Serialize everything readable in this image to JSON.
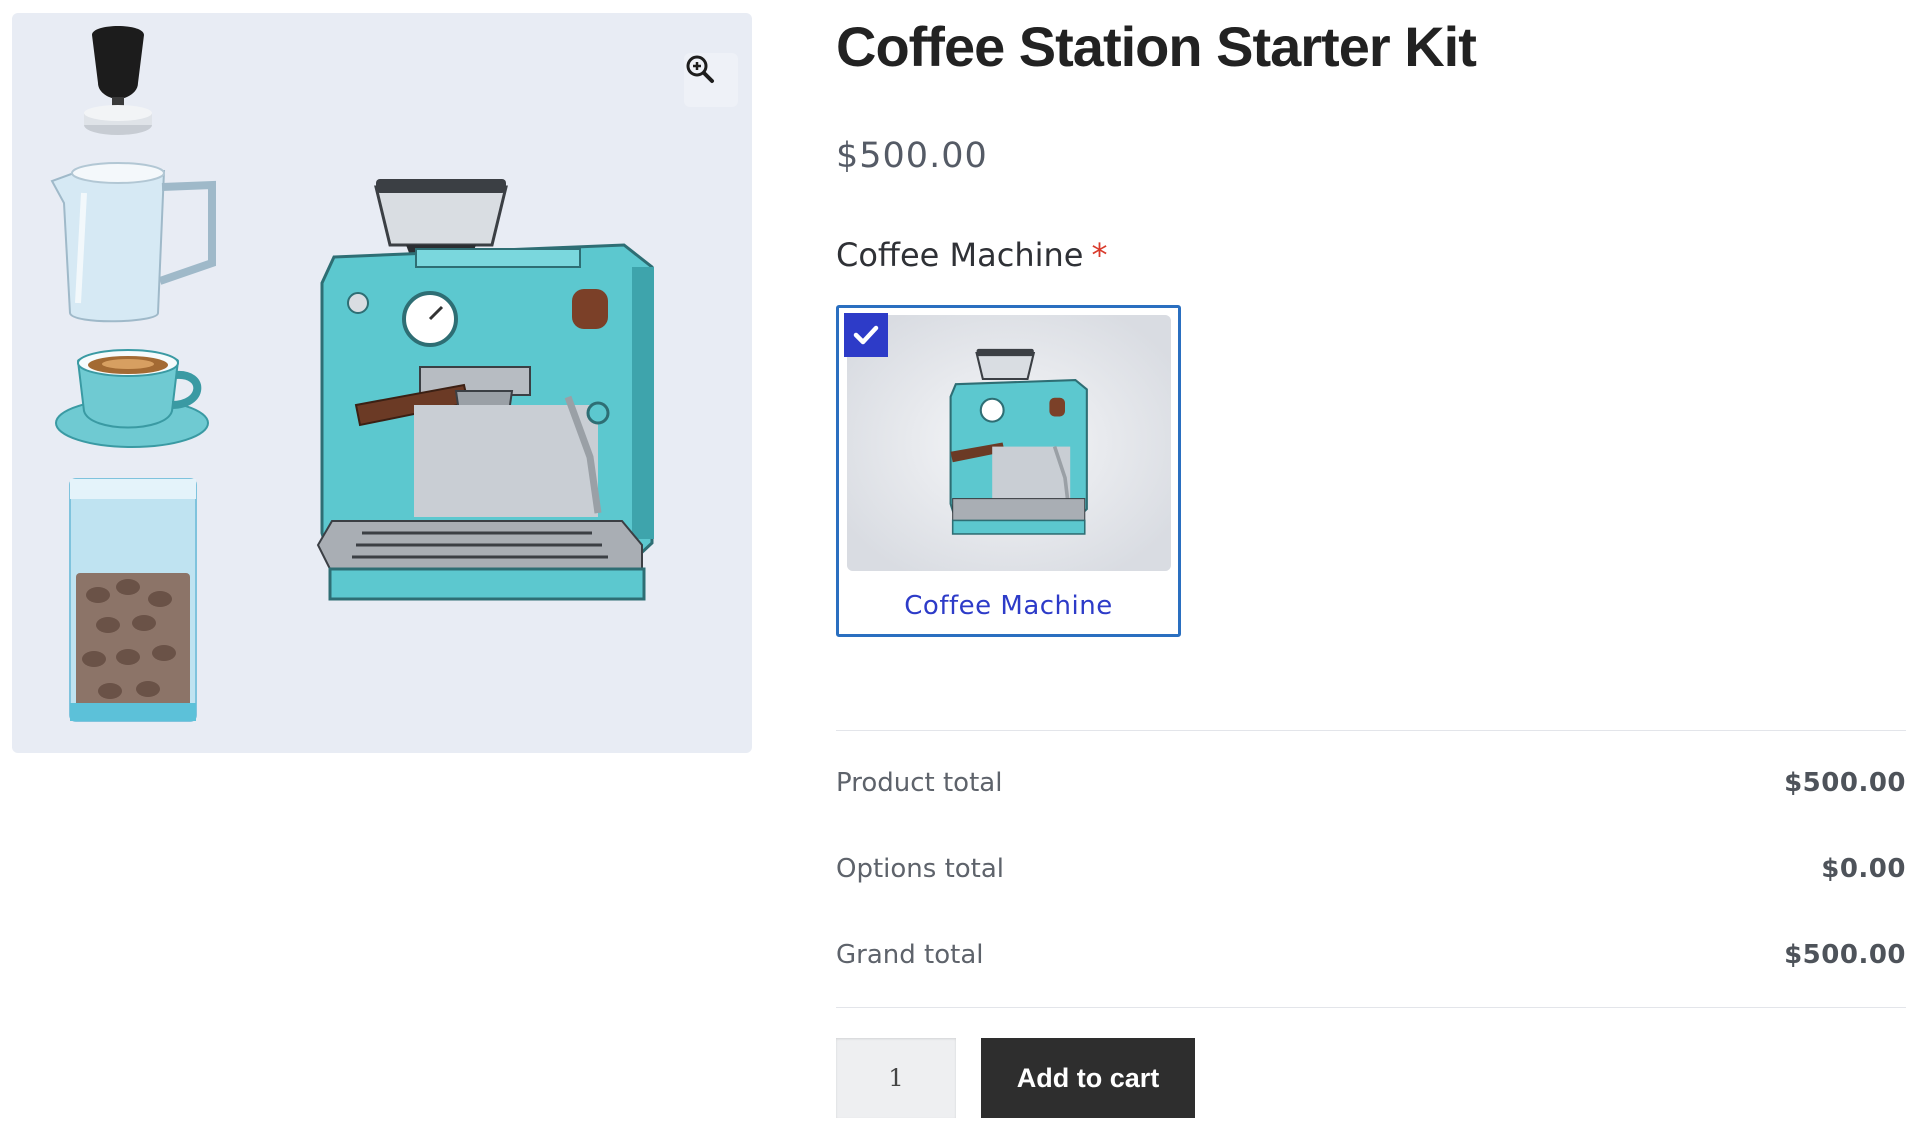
{
  "product": {
    "title": "Coffee Station Starter Kit",
    "price": "$500.00"
  },
  "gallery": {
    "zoom_icon": "zoom-in-icon",
    "image_subject": "coffee-station-kit-illustration"
  },
  "options": {
    "label": "Coffee Machine",
    "required_mark": "*",
    "choices": [
      {
        "name": "Coffee Machine",
        "selected": true,
        "icon": "checkmark-icon"
      }
    ]
  },
  "totals": {
    "rows": [
      {
        "label": "Product total",
        "value": "$500.00"
      },
      {
        "label": "Options total",
        "value": "$0.00"
      },
      {
        "label": "Grand total",
        "value": "$500.00"
      }
    ]
  },
  "cart": {
    "quantity": "1",
    "add_button_label": "Add to cart"
  },
  "colors": {
    "accent_blue": "#2d3bc8",
    "card_border": "#2a6fc0",
    "required_red": "#d93a2b",
    "button_dark": "#2e2e2e",
    "gallery_bg": "#e8ecf4",
    "machine_teal": "#5cc8cf"
  }
}
